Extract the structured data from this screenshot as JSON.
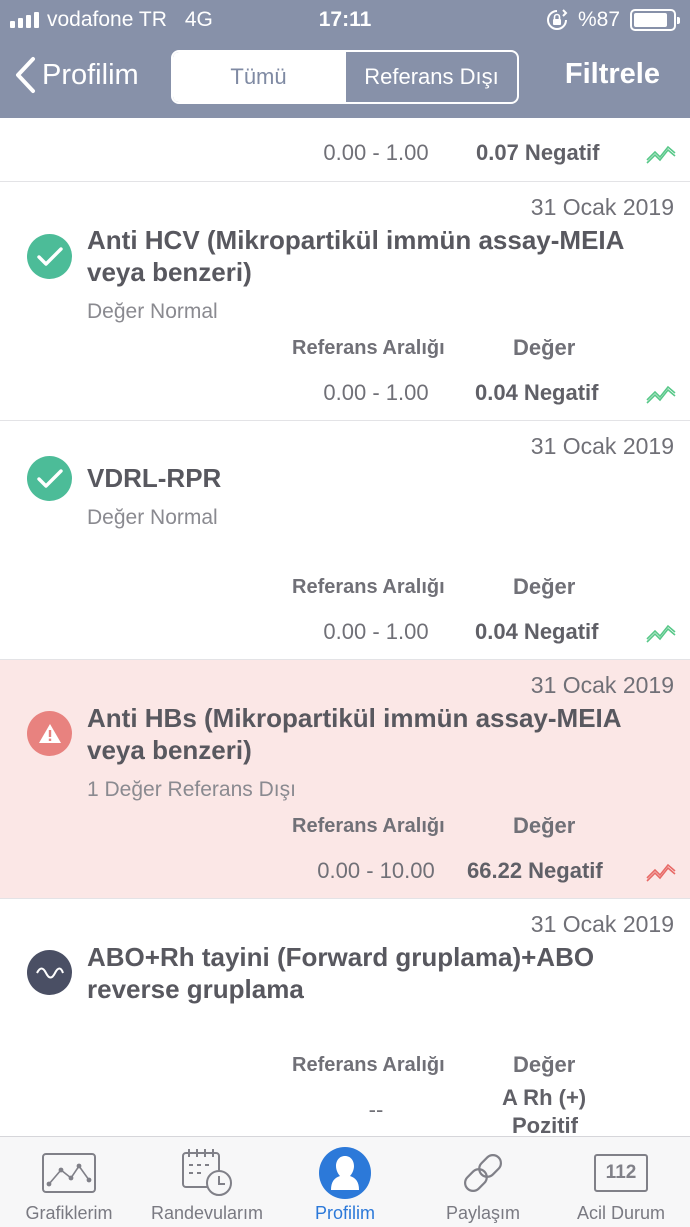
{
  "status_bar": {
    "carrier": "vodafone TR",
    "network": "4G",
    "time": "17:11",
    "battery": "%87"
  },
  "nav": {
    "back_label": "Profilim",
    "segments": [
      "Tümü",
      "Referans Dışı"
    ],
    "filter_label": "Filtrele"
  },
  "colors": {
    "header": "#8791a9",
    "ok": "#4cbc98",
    "warn": "#e8827f",
    "alert_bg": "#fbe7e6",
    "tab_active": "#2c79d9"
  },
  "partial_card": {
    "range": "0.00 - 1.00",
    "value": "0.07 Negatif",
    "trend_icon": "trend-up-green-icon"
  },
  "results": [
    {
      "date": "31 Ocak 2019",
      "title": "Anti HCV (Mikropartikül immün assay-MEIA veya benzeri)",
      "subtitle": "Değer Normal",
      "range_label": "Referans Aralığı",
      "value_label": "Değer",
      "range": "0.00 - 1.00",
      "value": "0.04 Negatif",
      "status_icon": "check-icon",
      "trend_icon": "trend-up-green-icon"
    },
    {
      "date": "31 Ocak 2019",
      "title": "VDRL-RPR",
      "subtitle": "Değer Normal",
      "range_label": "Referans Aralığı",
      "value_label": "Değer",
      "range": "0.00 - 1.00",
      "value": "0.04 Negatif",
      "status_icon": "check-icon",
      "trend_icon": "trend-up-green-icon"
    },
    {
      "date": "31 Ocak 2019",
      "title": "Anti HBs (Mikropartikül immün assay-MEIA veya benzeri)",
      "subtitle": "1 Değer Referans Dışı",
      "range_label": "Referans Aralığı",
      "value_label": "Değer",
      "range": "0.00 - 10.00",
      "value": "66.22 Negatif",
      "status_icon": "warning-icon",
      "trend_icon": "trend-up-red-icon"
    },
    {
      "date": "31 Ocak 2019",
      "title": "ABO+Rh tayini (Forward gruplama)+ABO reverse gruplama",
      "subtitle": "",
      "range_label": "Referans Aralığı",
      "value_label": "Değer",
      "range": "--",
      "value_line1": "A Rh (+)",
      "value_line2": "Pozitif",
      "status_icon": "wave-icon"
    }
  ],
  "tabs": [
    {
      "label": "Grafiklerim",
      "icon": "chart-icon"
    },
    {
      "label": "Randevularım",
      "icon": "calendar-clock-icon"
    },
    {
      "label": "Profilim",
      "icon": "profile-icon"
    },
    {
      "label": "Paylaşım",
      "icon": "link-icon"
    },
    {
      "label": "Acil Durum",
      "icon": "emergency-112-icon",
      "badge": "112"
    }
  ]
}
